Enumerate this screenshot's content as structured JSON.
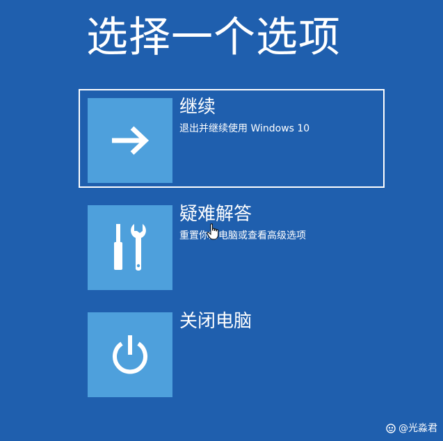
{
  "page": {
    "title": "选择一个选项"
  },
  "options": [
    {
      "title": "继续",
      "description": "退出并继续使用 Windows 10",
      "icon": "arrow-right-icon",
      "selected": true
    },
    {
      "title": "疑难解答",
      "description": "重置你的电脑或查看高级选项",
      "icon": "screwdriver-wrench-icon",
      "selected": false
    },
    {
      "title": "关闭电脑",
      "description": "",
      "icon": "power-icon",
      "selected": false
    }
  ],
  "watermark": {
    "text": "@光淼君"
  },
  "colors": {
    "background": "#1f5fae",
    "tile": "#4ea0dc",
    "text": "#ffffff",
    "selection_border": "#ffffff"
  }
}
